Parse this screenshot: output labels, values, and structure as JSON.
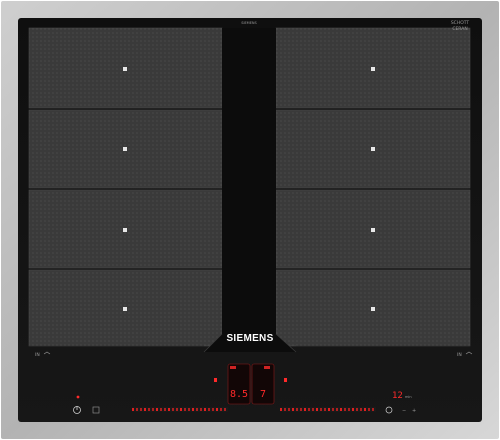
{
  "product": {
    "brand": "SIEMENS",
    "model_text": "SIEMENS",
    "glass_badge_lines": [
      "SCHOTT",
      "CERAN"
    ],
    "zone_label_left": "IN",
    "zone_label_right": "IN"
  },
  "controls": {
    "left_display_value": "8.5",
    "right_display_value": "7",
    "timer_value": "12",
    "timer_unit": "min"
  },
  "colors": {
    "frame": "#b9b9b9",
    "glass": "#111111",
    "zone_fill": "#3a3a3a",
    "indicator_red": "#ff2a2a"
  },
  "cooking_zones": {
    "left_column": 4,
    "right_column": 4
  }
}
